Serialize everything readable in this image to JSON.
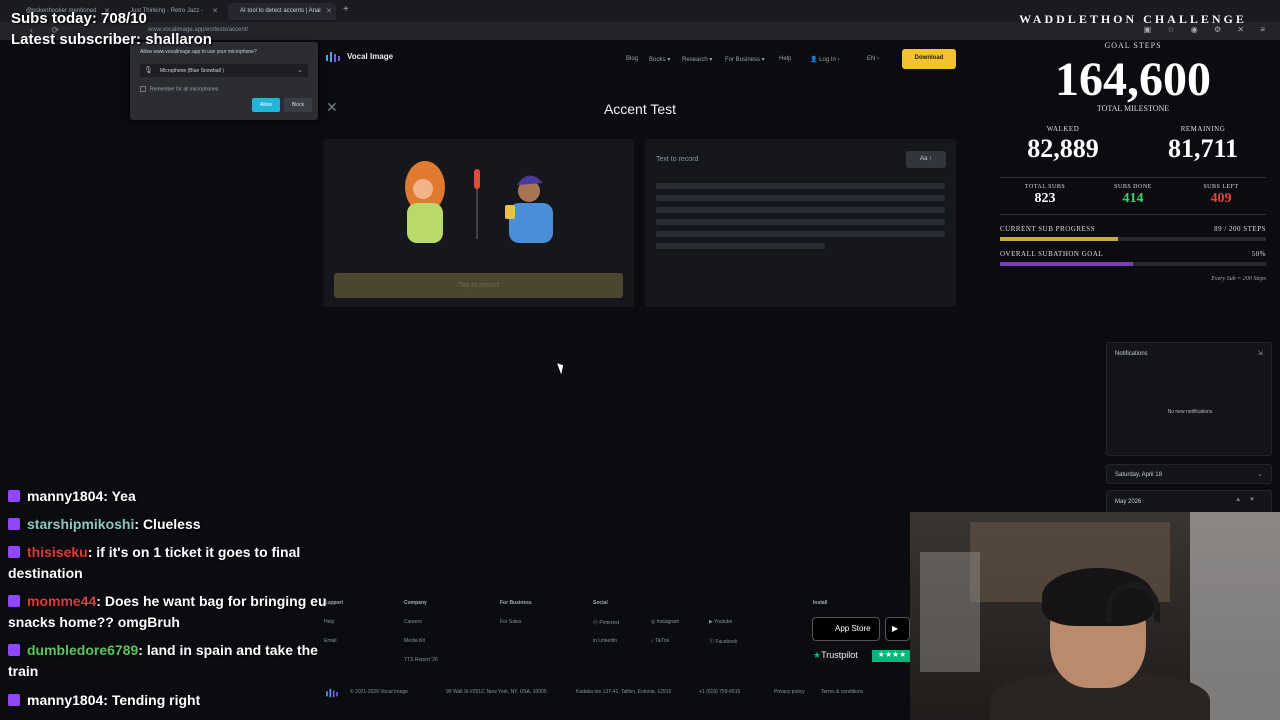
{
  "browser": {
    "tabs": [
      {
        "label": "@pokenhooker mentioned"
      },
      {
        "label": "Just Thinking - Retro Jazz -"
      },
      {
        "label": "AI tool to detect accents | Anal"
      }
    ],
    "new_tab_icon": "plus-icon",
    "url": "www.vocalimage.app/en/tests/accent/"
  },
  "permission_popup": {
    "title": "Allow www.vocalimage.app to use your microphone?",
    "device": "Microphone (Blue Snowball )",
    "remember": "Remember for all microphones",
    "allow": "Allow",
    "block": "Block"
  },
  "site": {
    "brand": "Vocal Image",
    "nav": [
      "Blog",
      "Books",
      "Research",
      "For Business",
      "Help",
      "Log In",
      "EN"
    ],
    "download": "Download",
    "page_title": "Accent Test",
    "tap_to_record": "Tap to record",
    "text_to_record": "Text to record",
    "font_toggle": "Aa"
  },
  "footer": {
    "support": {
      "title": "Support",
      "links": [
        "Help",
        "Email"
      ]
    },
    "company": {
      "title": "Company",
      "links": [
        "Careers",
        "Media Kit",
        "TTS Report '26"
      ]
    },
    "business": {
      "title": "For Business",
      "links": [
        "For Sales"
      ]
    },
    "social": {
      "title": "Social",
      "links": [
        "Pinterest",
        "Instagram",
        "Youtube",
        "LinkedIn",
        "TikTok",
        "Facebook"
      ]
    },
    "install": {
      "title": "Install",
      "app_store": "App Store",
      "trustpilot": "Trustpilot"
    },
    "copyright": "© 2021-2026 Vocal Image",
    "address1": "99 Wall St #2512, New York, NY, USA, 10005",
    "address2": "Kadaka tee 137-41, Tallinn, Estonia, 12915",
    "phone": "+1 (619) 759-6515",
    "privacy": "Privacy policy",
    "terms": "Terms & conditions"
  },
  "overlay": {
    "subs_today": "Subs today: 708/10",
    "latest_subscriber": "Latest subscriber: shallaron",
    "challenge": "WADDLETHON CHALLENGE",
    "goal_steps_label": "GOAL STEPS",
    "goal_steps": "164,600",
    "total_milestone": "TOTAL MILESTONE",
    "walked_label": "WALKED",
    "walked": "82,889",
    "remaining_label": "REMAINING",
    "remaining": "81,711",
    "total_subs_label": "TOTAL SUBS",
    "total_subs": "823",
    "subs_done_label": "SUBS DONE",
    "subs_done": "414",
    "subs_left_label": "SUBS LEFT",
    "subs_left": "409",
    "current_sub_progress_label": "CURRENT SUB PROGRESS",
    "current_sub_progress": "89 / 200 STEPS",
    "current_sub_fraction": 0.445,
    "overall_goal_label": "OVERALL SUBATHON GOAL",
    "overall_goal": "50%",
    "overall_fraction": 0.5,
    "every_sub": "Every Sub = 200 Steps",
    "colors": {
      "gold": "#c8a64a",
      "purple": "#7a3fb8",
      "green": "#3fd06a",
      "red": "#e0443a"
    }
  },
  "widgets": {
    "notifications_title": "Notifications",
    "no_notifications": "No new notifications",
    "date": "Saturday, April 18",
    "month": "May 2026"
  },
  "chat": [
    {
      "user": "manny1804",
      "text": "Yea",
      "color": "#ffffff"
    },
    {
      "user": "starshipmikoshi",
      "text": "Clueless",
      "color": "#8fc8c0"
    },
    {
      "user": "thisiseku",
      "text": "if it's on 1 ticket it goes to final destination",
      "color": "#e03b3b"
    },
    {
      "user": "momme44",
      "text": "Does he want bag for bringing eu snacks home?? omgBruh",
      "color": "#e03b3b"
    },
    {
      "user": "dumbledore6789",
      "text": "land in spain and take the train",
      "color": "#5ec45e"
    },
    {
      "user": "manny1804",
      "text": "Tending right",
      "color": "#ffffff"
    }
  ]
}
